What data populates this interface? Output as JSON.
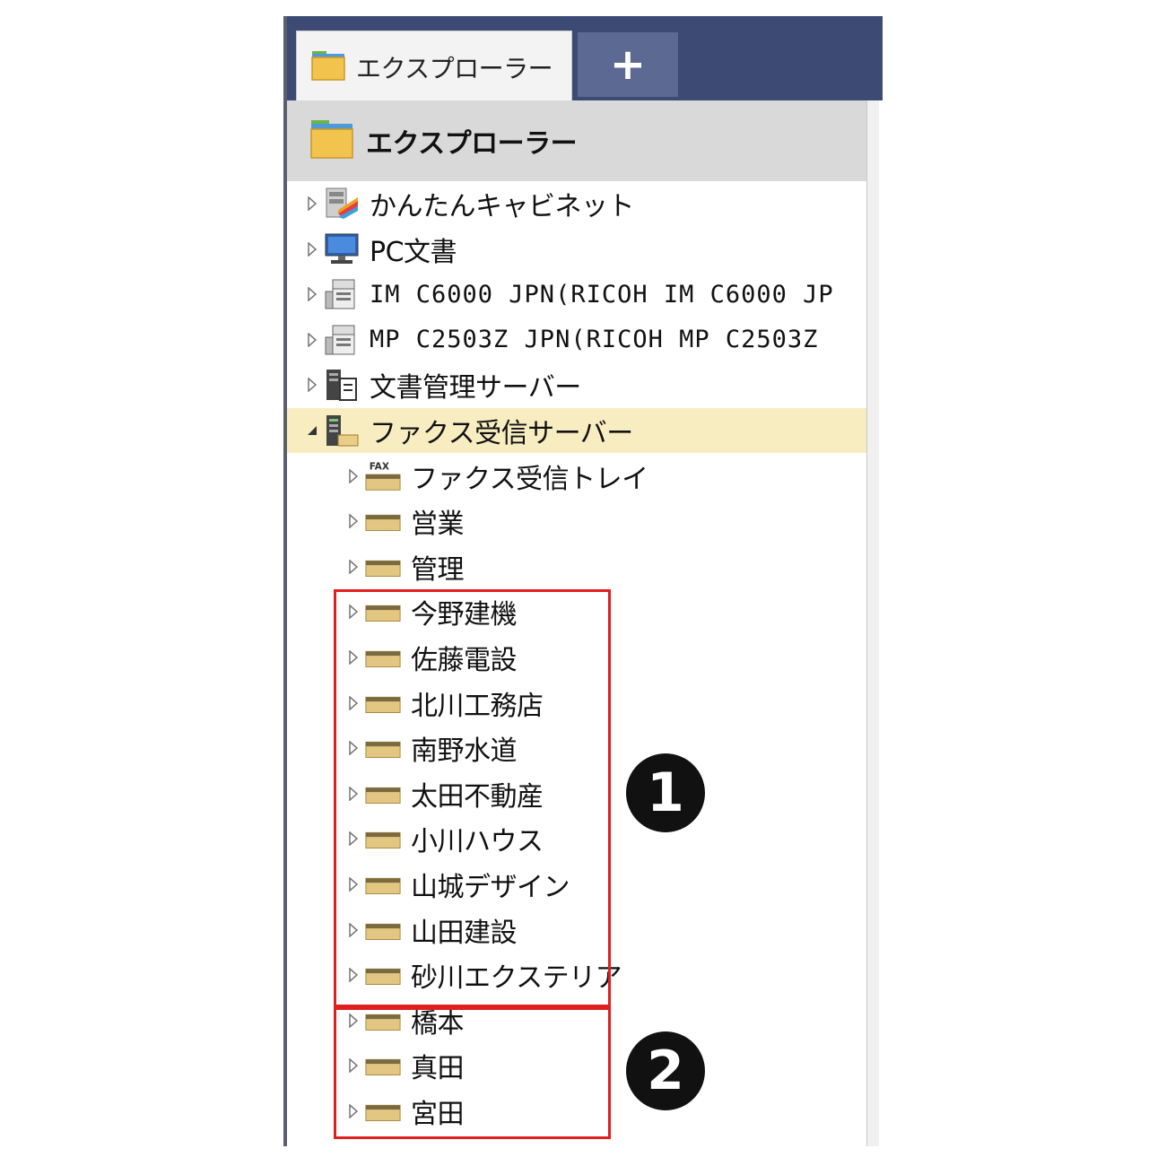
{
  "tab": {
    "title": "エクスプローラー",
    "add_symbol": "+"
  },
  "panel": {
    "title": "エクスプローラー"
  },
  "tree": [
    {
      "label": "かんたんキャビネット",
      "icon": "cabinet-icon",
      "level": 0,
      "expanded": false
    },
    {
      "label": "PC文書",
      "icon": "computer-icon",
      "level": 0,
      "expanded": false
    },
    {
      "label": "IM C6000 JPN(RICOH IM C6000 JP",
      "icon": "printer-icon",
      "level": 0,
      "expanded": false
    },
    {
      "label": "MP C2503Z JPN(RICOH MP C2503Z",
      "icon": "printer-icon",
      "level": 0,
      "expanded": false
    },
    {
      "label": "文書管理サーバー",
      "icon": "document-server-icon",
      "level": 0,
      "expanded": false
    },
    {
      "label": "ファクス受信サーバー",
      "icon": "fax-server-icon",
      "level": 0,
      "expanded": true,
      "selected": true
    },
    {
      "label": "ファクス受信トレイ",
      "icon": "fax-tray-icon",
      "level": 1,
      "expanded": false
    },
    {
      "label": "営業",
      "icon": "tray-icon",
      "level": 1,
      "expanded": false
    },
    {
      "label": "管理",
      "icon": "tray-icon",
      "level": 1,
      "expanded": false
    },
    {
      "label": "今野建機",
      "icon": "tray-icon",
      "level": 1,
      "expanded": false
    },
    {
      "label": "佐藤電設",
      "icon": "tray-icon",
      "level": 1,
      "expanded": false
    },
    {
      "label": "北川工務店",
      "icon": "tray-icon",
      "level": 1,
      "expanded": false
    },
    {
      "label": "南野水道",
      "icon": "tray-icon",
      "level": 1,
      "expanded": false
    },
    {
      "label": "太田不動産",
      "icon": "tray-icon",
      "level": 1,
      "expanded": false
    },
    {
      "label": "小川ハウス",
      "icon": "tray-icon",
      "level": 1,
      "expanded": false
    },
    {
      "label": "山城デザイン",
      "icon": "tray-icon",
      "level": 1,
      "expanded": false
    },
    {
      "label": "山田建設",
      "icon": "tray-icon",
      "level": 1,
      "expanded": false
    },
    {
      "label": "砂川エクステリア",
      "icon": "tray-icon",
      "level": 1,
      "expanded": false
    },
    {
      "label": "橋本",
      "icon": "tray-icon",
      "level": 1,
      "expanded": false
    },
    {
      "label": "真田",
      "icon": "tray-icon",
      "level": 1,
      "expanded": false
    },
    {
      "label": "宮田",
      "icon": "tray-icon",
      "level": 1,
      "expanded": false
    }
  ],
  "annotations": {
    "group1": "1",
    "group2": "2"
  },
  "colors": {
    "tabbar": "#3d4a73",
    "selected_row": "#f8edc1",
    "highlight": "#e02020"
  }
}
